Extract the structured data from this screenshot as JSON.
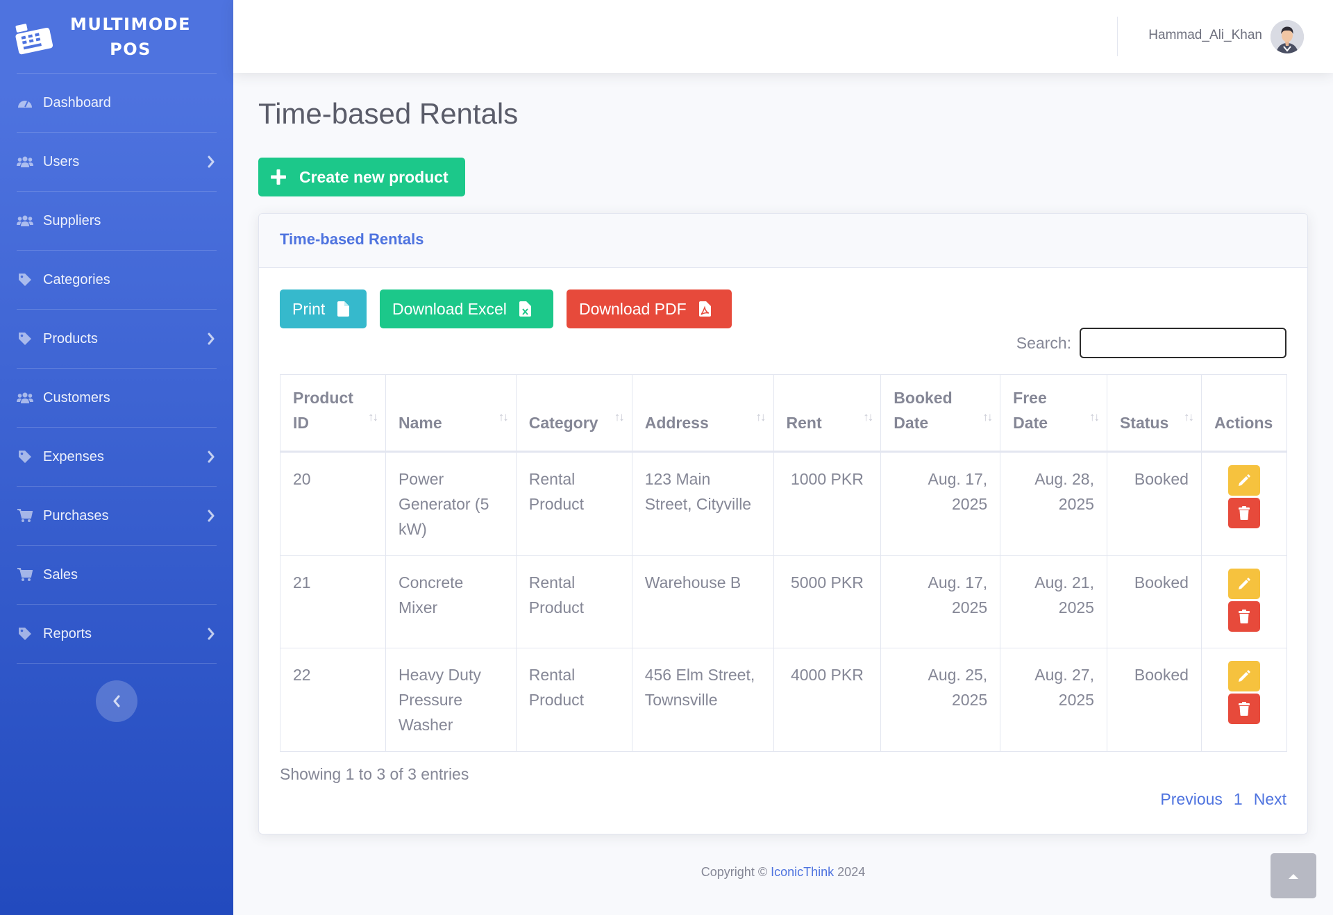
{
  "brand": {
    "line1": "MULTIMODE",
    "line2": "POS"
  },
  "sidebar": {
    "items": [
      {
        "label": "Dashboard",
        "icon": "tachometer-icon",
        "has_submenu": false
      },
      {
        "label": "Users",
        "icon": "users-icon",
        "has_submenu": true
      },
      {
        "label": "Suppliers",
        "icon": "users-icon",
        "has_submenu": false
      },
      {
        "label": "Categories",
        "icon": "tag-icon",
        "has_submenu": false
      },
      {
        "label": "Products",
        "icon": "tag-icon",
        "has_submenu": true
      },
      {
        "label": "Customers",
        "icon": "users-icon",
        "has_submenu": false
      },
      {
        "label": "Expenses",
        "icon": "tag-icon",
        "has_submenu": true
      },
      {
        "label": "Purchases",
        "icon": "cart-icon",
        "has_submenu": true
      },
      {
        "label": "Sales",
        "icon": "cart-icon",
        "has_submenu": false
      },
      {
        "label": "Reports",
        "icon": "tag-icon",
        "has_submenu": true
      }
    ]
  },
  "topbar": {
    "user_name": "Hammad_Ali_Khan"
  },
  "page": {
    "title": "Time-based Rentals",
    "create_button": "Create new product"
  },
  "card": {
    "header": "Time-based Rentals",
    "print_label": "Print",
    "excel_label": "Download Excel",
    "pdf_label": "Download PDF",
    "search_label": "Search:",
    "search_value": ""
  },
  "table": {
    "headers": {
      "product_id": [
        "Product",
        "ID"
      ],
      "name": "Name",
      "category": "Category",
      "address": "Address",
      "rent": "Rent",
      "booked_date": [
        "Booked",
        "Date"
      ],
      "free_date": [
        "Free",
        "Date"
      ],
      "status": "Status",
      "actions": "Actions"
    },
    "rows": [
      {
        "id": "20",
        "name": "Power Generator (5 kW)",
        "category": "Rental Product",
        "address": "123 Main Street, Cityville",
        "rent": "1000 PKR",
        "booked": "Aug. 17, 2025",
        "free": "Aug. 28, 2025",
        "status": "Booked"
      },
      {
        "id": "21",
        "name": "Concrete Mixer",
        "category": "Rental Product",
        "address": "Warehouse B",
        "rent": "5000 PKR",
        "booked": "Aug. 17, 2025",
        "free": "Aug. 21, 2025",
        "status": "Booked"
      },
      {
        "id": "22",
        "name": "Heavy Duty Pressure Washer",
        "category": "Rental Product",
        "address": "456 Elm Street, Townsville",
        "rent": "4000 PKR",
        "booked": "Aug. 25, 2025",
        "free": "Aug. 27, 2025",
        "status": "Booked"
      }
    ],
    "info": "Showing 1 to 3 of 3 entries",
    "pager": {
      "previous": "Previous",
      "current": "1",
      "next": "Next"
    }
  },
  "footer": {
    "prefix": "Copyright ©",
    "company": "IconicThink",
    "year": "2024"
  },
  "colors": {
    "sidebar_start": "#4e73df",
    "sidebar_end": "#224abe",
    "primary": "#4e73df",
    "success": "#1cc88a",
    "info": "#36b9cc",
    "danger": "#e74a3b",
    "warning": "#f6c23e"
  }
}
